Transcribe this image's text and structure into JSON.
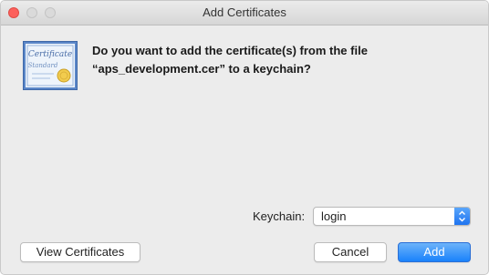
{
  "window": {
    "title": "Add Certificates"
  },
  "message": {
    "line1": "Do you want to add the certificate(s) from the file",
    "line2": "“aps_development.cer” to a keychain?"
  },
  "certificate_icon": {
    "title_text": "Certificate",
    "subtitle_text": "Standard"
  },
  "keychain": {
    "label": "Keychain:",
    "selected": "login"
  },
  "buttons": {
    "view_certificates": "View Certificates",
    "cancel": "Cancel",
    "add": "Add"
  },
  "colors": {
    "accent": "#1a82fb",
    "close": "#fc605c"
  }
}
